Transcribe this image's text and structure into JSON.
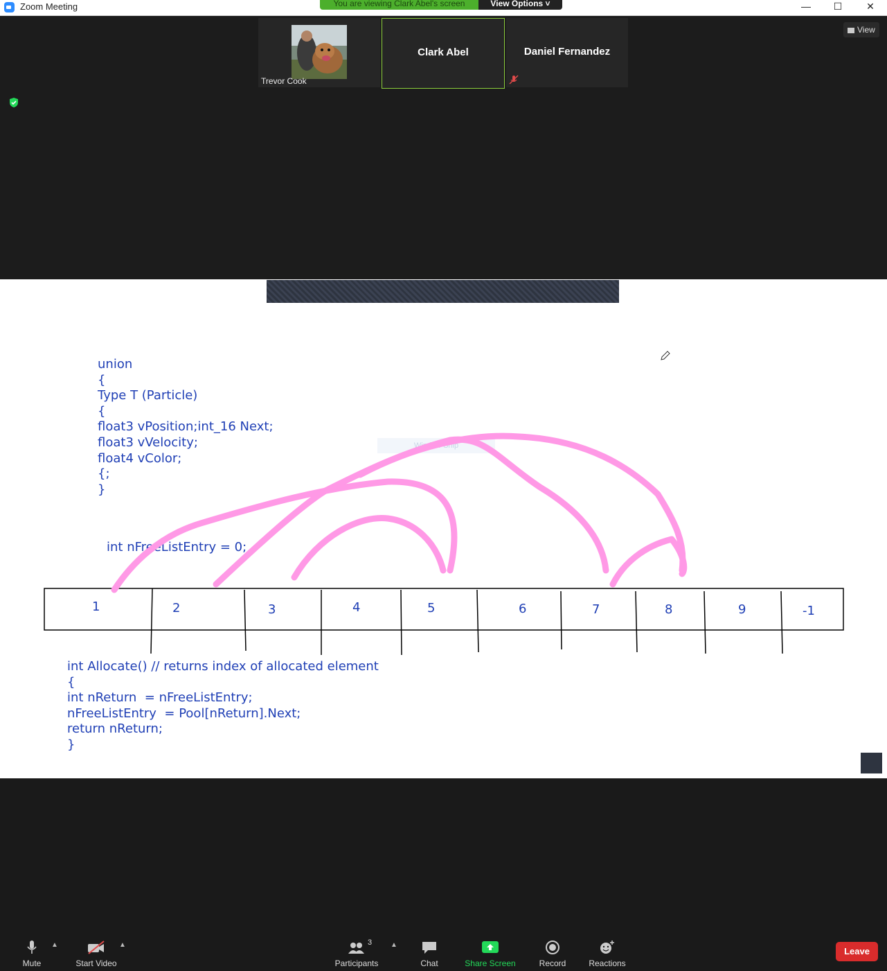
{
  "window": {
    "title": "Zoom Meeting"
  },
  "banner": {
    "viewing_text": "You are viewing Clark Abel's screen",
    "view_options": "View Options ˅"
  },
  "participants_strip": {
    "tiles": [
      {
        "name": "Trevor Cook"
      },
      {
        "name": "Clark Abel"
      },
      {
        "name": "Daniel Fernandez"
      }
    ],
    "view_button": "View"
  },
  "whiteboard": {
    "union_code": "union\n{\nType T (Particle)\n{\nfloat3 vPosition;int_16 Next;\nfloat3 vVelocity;\nfloat4 vColor;\n{;\n}",
    "free_list_line": "int nFreeListEntry = 0;",
    "allocate_code": "int Allocate() // returns index of allocated element\n{\nint nReturn  = nFreeListEntry;\nnFreeListEntry  = Pool[nReturn].Next;\nreturn nReturn;\n}",
    "cells": [
      "1",
      "2",
      "3",
      "4",
      "5",
      "6",
      "7",
      "8",
      "9",
      "-1"
    ],
    "faint_label": "Window Snip"
  },
  "toolbar": {
    "mute": "Mute",
    "start_video": "Start Video",
    "participants": "Participants",
    "participants_count": "3",
    "chat": "Chat",
    "share_screen": "Share Screen",
    "record": "Record",
    "reactions": "Reactions",
    "leave": "Leave"
  },
  "colors": {
    "share_green": "#23d959",
    "leave_red": "#d92c2c",
    "ink_pink": "#ff99e6",
    "code_blue": "#1f3fb5"
  }
}
